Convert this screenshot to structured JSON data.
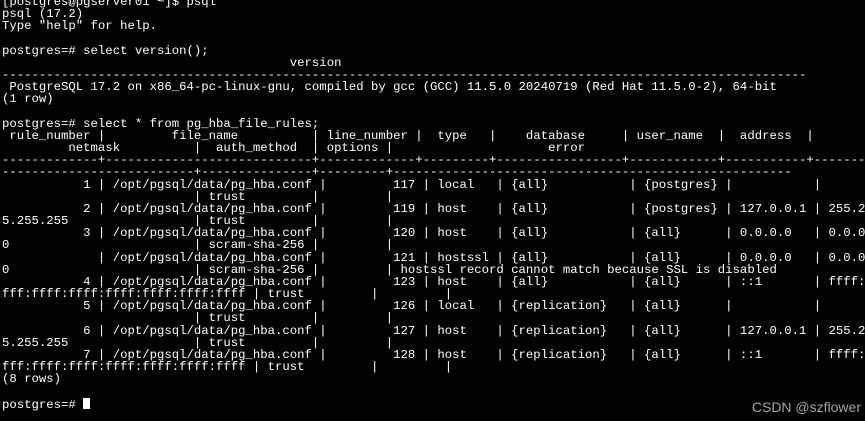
{
  "terminal": {
    "background": "#000000",
    "foreground": "#ffffff",
    "lines": [
      "[postgres@pgserver01 ~]$ psql",
      "psql (17.2)",
      "Type \"help\" for help.",
      "",
      "postgres=# select version();",
      "                                       version",
      "-------------------------------------------------------------------------------------------------------------",
      " PostgreSQL 17.2 on x86_64-pc-linux-gnu, compiled by gcc (GCC) 11.5.0 20240719 (Red Hat 11.5.0-2), 64-bit",
      "(1 row)",
      "",
      "postgres=# select * from pg_hba_file_rules;",
      " rule_number |         file_name          | line_number |  type   |    database     | user_name  |  address  |",
      "         netmask          |  auth_method  | options |                     error",
      "-------------+----------------------------+-------------+---------+-----------------+------------+-----------+-------",
      "--------------------------+---------------+---------+------------------------------------------------------",
      "           1 | /opt/pgsql/data/pg_hba.conf |         117 | local   | {all}           | {postgres} |           |",
      "                          | trust         |         |",
      "           2 | /opt/pgsql/data/pg_hba.conf |         119 | host    | {all}           | {postgres} | 127.0.0.1 | 255.25",
      "5.255.255                 | trust         |         |",
      "           3 | /opt/pgsql/data/pg_hba.conf |         120 | host    | {all}           | {all}      | 0.0.0.0   | 0.0.0.",
      "0                         | scram-sha-256 |         |",
      "             | /opt/pgsql/data/pg_hba.conf |         121 | hostssl | {all}           | {all}      | 0.0.0.0   | 0.0.0.",
      "0                         | scram-sha-256 |         | hostssl record cannot match because SSL is disabled",
      "           4 | /opt/pgsql/data/pg_hba.conf |         123 | host    | {all}           | {all}      | ::1       | ffff:f",
      "fff:ffff:ffff:ffff:ffff:ffff:ffff | trust         |         |",
      "           5 | /opt/pgsql/data/pg_hba.conf |         126 | local   | {replication}   | {all}      |           |",
      "                          | trust         |         |",
      "           6 | /opt/pgsql/data/pg_hba.conf |         127 | host    | {replication}   | {all}      | 127.0.0.1 | 255.25",
      "5.255.255                 | trust         |         |",
      "           7 | /opt/pgsql/data/pg_hba.conf |         128 | host    | {replication}   | {all}      | ::1       | ffff:f",
      "fff:ffff:ffff:ffff:ffff:ffff:ffff | trust         |         |",
      "(8 rows)",
      ""
    ],
    "prompt": "postgres=# "
  },
  "watermark": "CSDN @szflower"
}
